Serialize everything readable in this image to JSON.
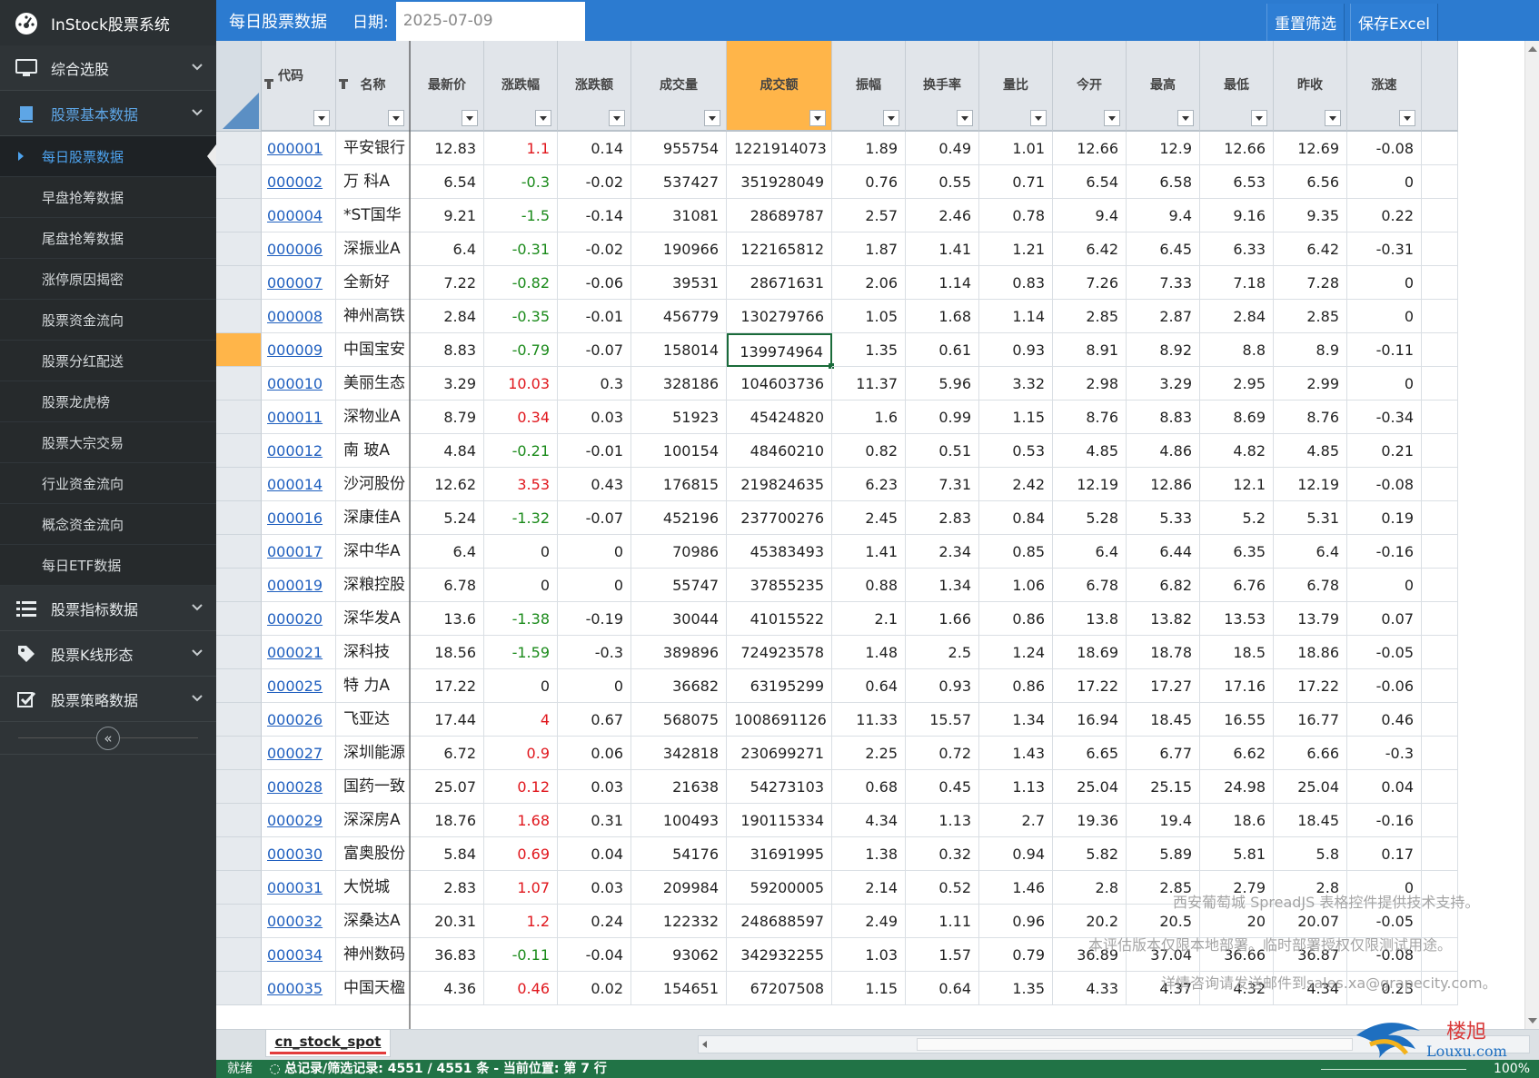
{
  "app": {
    "title": "InStock股票系统"
  },
  "sidebar": {
    "groups": [
      {
        "label": "综合选股",
        "icon": "monitor-icon"
      },
      {
        "label": "股票基本数据",
        "icon": "book-icon",
        "active": true
      }
    ],
    "sub_items": [
      {
        "label": "每日股票数据",
        "current": true
      },
      {
        "label": "早盘抢筹数据"
      },
      {
        "label": "尾盘抢筹数据"
      },
      {
        "label": "涨停原因揭密"
      },
      {
        "label": "股票资金流向"
      },
      {
        "label": "股票分红配送"
      },
      {
        "label": "股票龙虎榜"
      },
      {
        "label": "股票大宗交易"
      },
      {
        "label": "行业资金流向"
      },
      {
        "label": "概念资金流向"
      },
      {
        "label": "每日ETF数据"
      }
    ],
    "bottom_groups": [
      {
        "label": "股票指标数据",
        "icon": "list-icon"
      },
      {
        "label": "股票K线形态",
        "icon": "tag-icon"
      },
      {
        "label": "股票策略数据",
        "icon": "checkbox-icon"
      }
    ],
    "collapse_glyph": "«"
  },
  "toolbar": {
    "title": "每日股票数据",
    "date_label": "日期:",
    "date_value": "2025-07-09",
    "reset_label": "重置筛选",
    "save_label": "保存Excel"
  },
  "grid": {
    "columns": [
      "代码",
      "名称",
      "最新价",
      "涨跌幅",
      "涨跌额",
      "成交量",
      "成交额",
      "振幅",
      "换手率",
      "量比",
      "今开",
      "最高",
      "最低",
      "昨收",
      "涨速"
    ],
    "selected_column": "成交额",
    "selected_row": 6,
    "rows": [
      [
        "000001",
        "平安银行",
        "12.83",
        "1.1",
        "0.14",
        "955754",
        "1221914073",
        "1.89",
        "0.49",
        "1.01",
        "12.66",
        "12.9",
        "12.66",
        "12.69",
        "-0.08"
      ],
      [
        "000002",
        "万 科A",
        "6.54",
        "-0.3",
        "-0.02",
        "537427",
        "351928049",
        "0.76",
        "0.55",
        "0.71",
        "6.54",
        "6.58",
        "6.53",
        "6.56",
        "0"
      ],
      [
        "000004",
        "*ST国华",
        "9.21",
        "-1.5",
        "-0.14",
        "31081",
        "28689787",
        "2.57",
        "2.46",
        "0.78",
        "9.4",
        "9.4",
        "9.16",
        "9.35",
        "0.22"
      ],
      [
        "000006",
        "深振业A",
        "6.4",
        "-0.31",
        "-0.02",
        "190966",
        "122165812",
        "1.87",
        "1.41",
        "1.21",
        "6.42",
        "6.45",
        "6.33",
        "6.42",
        "-0.31"
      ],
      [
        "000007",
        "全新好",
        "7.22",
        "-0.82",
        "-0.06",
        "39531",
        "28671631",
        "2.06",
        "1.14",
        "0.83",
        "7.26",
        "7.33",
        "7.18",
        "7.28",
        "0"
      ],
      [
        "000008",
        "神州高铁",
        "2.84",
        "-0.35",
        "-0.01",
        "456779",
        "130279766",
        "1.05",
        "1.68",
        "1.14",
        "2.85",
        "2.87",
        "2.84",
        "2.85",
        "0"
      ],
      [
        "000009",
        "中国宝安",
        "8.83",
        "-0.79",
        "-0.07",
        "158014",
        "139974964",
        "1.35",
        "0.61",
        "0.93",
        "8.91",
        "8.92",
        "8.8",
        "8.9",
        "-0.11"
      ],
      [
        "000010",
        "美丽生态",
        "3.29",
        "10.03",
        "0.3",
        "328186",
        "104603736",
        "11.37",
        "5.96",
        "3.32",
        "2.98",
        "3.29",
        "2.95",
        "2.99",
        "0"
      ],
      [
        "000011",
        "深物业A",
        "8.79",
        "0.34",
        "0.03",
        "51923",
        "45424820",
        "1.6",
        "0.99",
        "1.15",
        "8.76",
        "8.83",
        "8.69",
        "8.76",
        "-0.34"
      ],
      [
        "000012",
        "南 玻A",
        "4.84",
        "-0.21",
        "-0.01",
        "100154",
        "48460210",
        "0.82",
        "0.51",
        "0.53",
        "4.85",
        "4.86",
        "4.82",
        "4.85",
        "0.21"
      ],
      [
        "000014",
        "沙河股份",
        "12.62",
        "3.53",
        "0.43",
        "176815",
        "219824635",
        "6.23",
        "7.31",
        "2.42",
        "12.19",
        "12.86",
        "12.1",
        "12.19",
        "-0.08"
      ],
      [
        "000016",
        "深康佳A",
        "5.24",
        "-1.32",
        "-0.07",
        "452196",
        "237700276",
        "2.45",
        "2.83",
        "0.84",
        "5.28",
        "5.33",
        "5.2",
        "5.31",
        "0.19"
      ],
      [
        "000017",
        "深中华A",
        "6.4",
        "0",
        "0",
        "70986",
        "45383493",
        "1.41",
        "2.34",
        "0.85",
        "6.4",
        "6.44",
        "6.35",
        "6.4",
        "-0.16"
      ],
      [
        "000019",
        "深粮控股",
        "6.78",
        "0",
        "0",
        "55747",
        "37855235",
        "0.88",
        "1.34",
        "1.06",
        "6.78",
        "6.82",
        "6.76",
        "6.78",
        "0"
      ],
      [
        "000020",
        "深华发A",
        "13.6",
        "-1.38",
        "-0.19",
        "30044",
        "41015522",
        "2.1",
        "1.66",
        "0.86",
        "13.8",
        "13.82",
        "13.53",
        "13.79",
        "0.07"
      ],
      [
        "000021",
        "深科技",
        "18.56",
        "-1.59",
        "-0.3",
        "389896",
        "724923578",
        "1.48",
        "2.5",
        "1.24",
        "18.69",
        "18.78",
        "18.5",
        "18.86",
        "-0.05"
      ],
      [
        "000025",
        "特 力A",
        "17.22",
        "0",
        "0",
        "36682",
        "63195299",
        "0.64",
        "0.93",
        "0.86",
        "17.22",
        "17.27",
        "17.16",
        "17.22",
        "-0.06"
      ],
      [
        "000026",
        "飞亚达",
        "17.44",
        "4",
        "0.67",
        "568075",
        "1008691126",
        "11.33",
        "15.57",
        "1.34",
        "16.94",
        "18.45",
        "16.55",
        "16.77",
        "0.46"
      ],
      [
        "000027",
        "深圳能源",
        "6.72",
        "0.9",
        "0.06",
        "342818",
        "230699271",
        "2.25",
        "0.72",
        "1.43",
        "6.65",
        "6.77",
        "6.62",
        "6.66",
        "-0.3"
      ],
      [
        "000028",
        "国药一致",
        "25.07",
        "0.12",
        "0.03",
        "21638",
        "54273103",
        "0.68",
        "0.45",
        "1.13",
        "25.04",
        "25.15",
        "24.98",
        "25.04",
        "0.04"
      ],
      [
        "000029",
        "深深房A",
        "18.76",
        "1.68",
        "0.31",
        "100493",
        "190115334",
        "4.34",
        "1.13",
        "2.7",
        "19.36",
        "19.4",
        "18.6",
        "18.45",
        "-0.16"
      ],
      [
        "000030",
        "富奥股份",
        "5.84",
        "0.69",
        "0.04",
        "54176",
        "31691995",
        "1.38",
        "0.32",
        "0.94",
        "5.82",
        "5.89",
        "5.81",
        "5.8",
        "0.17"
      ],
      [
        "000031",
        "大悦城",
        "2.83",
        "1.07",
        "0.03",
        "209984",
        "59200005",
        "2.14",
        "0.52",
        "1.46",
        "2.8",
        "2.85",
        "2.79",
        "2.8",
        "0"
      ],
      [
        "000032",
        "深桑达A",
        "20.31",
        "1.2",
        "0.24",
        "122332",
        "248688597",
        "2.49",
        "1.11",
        "0.96",
        "20.2",
        "20.5",
        "20",
        "20.07",
        "-0.05"
      ],
      [
        "000034",
        "神州数码",
        "36.83",
        "-0.11",
        "-0.04",
        "93062",
        "342932255",
        "1.03",
        "1.57",
        "0.79",
        "36.89",
        "37.04",
        "36.66",
        "36.87",
        "-0.08"
      ],
      [
        "000035",
        "中国天楹",
        "4.36",
        "0.46",
        "0.02",
        "154651",
        "67207508",
        "1.15",
        "0.64",
        "1.35",
        "4.33",
        "4.37",
        "4.32",
        "4.34",
        "0.23"
      ]
    ]
  },
  "watermark": {
    "line1": "西安葡萄城 SpreadJS 表格控件提供技术支持。",
    "line2": "本评估版本仅限本地部署。临时部署授权仅限测试用途。",
    "line3": "详情咨询请发送邮件到sales.xa@grapecity.com。"
  },
  "sheet_tab": "cn_stock_spot",
  "status": {
    "ready": "就绪",
    "records": "总记录/筛选记录: 4551 / 4551 条 - 当前位置: 第 7 行",
    "zoom": "100%"
  },
  "corner_logo": {
    "text1": "楼旭",
    "text2": "Louxu.com"
  },
  "colors": {
    "accent": "#2c7bd0",
    "selected": "#ffb549",
    "up": "#e0161c",
    "down": "#1a8a1a",
    "status": "#217346"
  }
}
